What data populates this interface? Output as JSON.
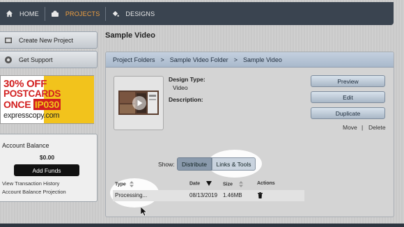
{
  "nav": {
    "home": "HOME",
    "projects": "PROJECTS",
    "designs": "DESIGNS",
    "accent_color": "#f0a040"
  },
  "sidebar": {
    "create_project": "Create New Project",
    "get_support": "Get Support",
    "promo": {
      "line1": "30% OFF",
      "line2": "POSTCARDS",
      "line3_prefix": "ONCE",
      "code": "IP030",
      "brand": "expresscopy.com"
    },
    "account": {
      "title": "Account Balance",
      "balance": "$0.00",
      "add_funds": "Add Funds",
      "history_link": "View Transaction History",
      "projection_link": "Account Balance Projection"
    }
  },
  "main": {
    "title": "Sample Video",
    "breadcrumb": [
      "Project Folders",
      "Sample Video Folder",
      "Sample Video"
    ],
    "breadcrumb_separator": ">",
    "design_type_label": "Design Type:",
    "design_type_value": "Video",
    "description_label": "Description:",
    "buttons": {
      "preview": "Preview",
      "edit": "Edit",
      "duplicate": "Duplicate"
    },
    "move": "Move",
    "link_separator": "|",
    "delete": "Delete",
    "show_label": "Show:",
    "segments": {
      "distribute": "Distribute",
      "links_tools": "Links & Tools"
    },
    "table": {
      "headers": {
        "type": "Type",
        "date": "Date",
        "size": "Size",
        "actions": "Actions"
      },
      "rows": [
        {
          "type": "Processing...",
          "date": "08/13/2019",
          "size": "1.46MB"
        }
      ]
    }
  }
}
